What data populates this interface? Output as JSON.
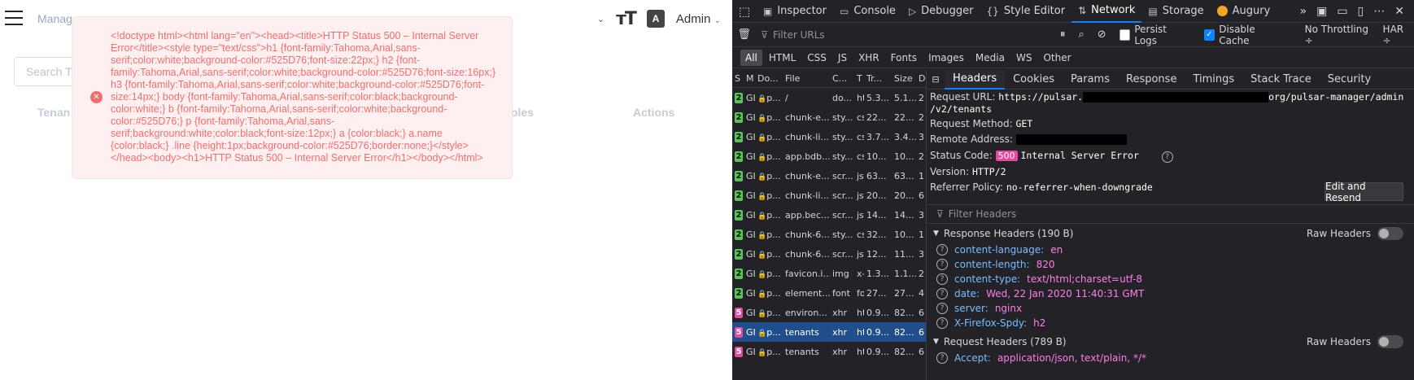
{
  "app": {
    "breadcrumb": "Manag",
    "admin_label": "Admin",
    "search_placeholder": "Search T",
    "table_headers": [
      "Tenan",
      "oles",
      "Actions"
    ],
    "error_message": "<!doctype html><html lang=\"en\"><head><title>HTTP Status 500 – Internal Server Error</title><style type=\"text/css\">h1 {font-family:Tahoma,Arial,sans-serif;color:white;background-color:#525D76;font-size:22px;} h2 {font-family:Tahoma,Arial,sans-serif;color:white;background-color:#525D76;font-size:16px;} h3 {font-family:Tahoma,Arial,sans-serif;color:white;background-color:#525D76;font-size:14px;} body {font-family:Tahoma,Arial,sans-serif;color:black;background-color:white;} b {font-family:Tahoma,Arial,sans-serif;color:white;background-color:#525D76;} p {font-family:Tahoma,Arial,sans-serif;background:white;color:black;font-size:12px;} a {color:black;} a.name {color:black;} .line {height:1px;background-color:#525D76;border:none;}</style></head><body><h1>HTTP Status 500 – Internal Server Error</h1></body></html>"
  },
  "devtools": {
    "tabs": [
      {
        "label": "Inspector",
        "icon": "inspector-icon"
      },
      {
        "label": "Console",
        "icon": "console-icon"
      },
      {
        "label": "Debugger",
        "icon": "debugger-icon"
      },
      {
        "label": "Style Editor",
        "icon": "style-editor-icon"
      },
      {
        "label": "Network",
        "icon": "network-icon"
      },
      {
        "label": "Storage",
        "icon": "storage-icon"
      },
      {
        "label": "Augury",
        "icon": "augury-icon"
      }
    ],
    "filter_placeholder": "Filter URLs",
    "persist_logs": "Persist Logs",
    "disable_cache": "Disable Cache",
    "throttling": "No Throttling ÷",
    "har": "HAR ÷",
    "type_filters": [
      "All",
      "HTML",
      "CSS",
      "JS",
      "XHR",
      "Fonts",
      "Images",
      "Media",
      "WS",
      "Other"
    ],
    "request_columns": [
      "S",
      "M",
      "Do...",
      "File",
      "C...",
      "T",
      "Tr...",
      "Size",
      "D"
    ],
    "requests": [
      {
        "status": "2",
        "method": "GI",
        "domain": "p...",
        "file": "/",
        "cause": "do...",
        "type": "ht",
        "transferred": "5.3...",
        "size": "5.1...",
        "extra": "2"
      },
      {
        "status": "2",
        "method": "GI",
        "domain": "p...",
        "file": "chunk-e...",
        "cause": "sty...",
        "type": "cs",
        "transferred": "22...",
        "size": "22...",
        "extra": "2"
      },
      {
        "status": "2",
        "method": "GI",
        "domain": "p...",
        "file": "chunk-li...",
        "cause": "sty...",
        "type": "cs",
        "transferred": "3.7...",
        "size": "3.4...",
        "extra": "3"
      },
      {
        "status": "2",
        "method": "GI",
        "domain": "p...",
        "file": "app.bdb...",
        "cause": "sty...",
        "type": "cs",
        "transferred": "10...",
        "size": "10...",
        "extra": "2"
      },
      {
        "status": "2",
        "method": "GI",
        "domain": "p...",
        "file": "chunk-e...",
        "cause": "scr...",
        "type": "js",
        "transferred": "63...",
        "size": "63...",
        "extra": "1"
      },
      {
        "status": "2",
        "method": "GI",
        "domain": "p...",
        "file": "chunk-li...",
        "cause": "scr...",
        "type": "js",
        "transferred": "20...",
        "size": "20...",
        "extra": "6"
      },
      {
        "status": "2",
        "method": "GI",
        "domain": "p...",
        "file": "app.bec...",
        "cause": "scr...",
        "type": "js",
        "transferred": "14...",
        "size": "14...",
        "extra": "3"
      },
      {
        "status": "2",
        "method": "GI",
        "domain": "p...",
        "file": "chunk-6...",
        "cause": "sty...",
        "type": "cs",
        "transferred": "32...",
        "size": "10...",
        "extra": "1"
      },
      {
        "status": "2",
        "method": "GI",
        "domain": "p...",
        "file": "chunk-6...",
        "cause": "scr...",
        "type": "js",
        "transferred": "12...",
        "size": "11...",
        "extra": "3"
      },
      {
        "status": "2",
        "method": "GI",
        "domain": "p...",
        "file": "favicon.i...",
        "cause": "img",
        "type": "x-",
        "transferred": "1.3...",
        "size": "1.1...",
        "extra": "2"
      },
      {
        "status": "2",
        "method": "GI",
        "domain": "p...",
        "file": "element...",
        "cause": "font",
        "type": "fo",
        "transferred": "27...",
        "size": "27...",
        "extra": "4"
      },
      {
        "status": "5",
        "method": "GI",
        "domain": "p...",
        "file": "environ...",
        "cause": "xhr",
        "type": "ht",
        "transferred": "0.9...",
        "size": "82...",
        "extra": "6"
      },
      {
        "status": "5",
        "method": "GI",
        "domain": "p...",
        "file": "tenants",
        "cause": "xhr",
        "type": "ht",
        "transferred": "0.9...",
        "size": "82...",
        "extra": "6"
      },
      {
        "status": "5",
        "method": "GI",
        "domain": "p...",
        "file": "tenants",
        "cause": "xhr",
        "type": "ht",
        "transferred": "0.9...",
        "size": "82...",
        "extra": "6"
      }
    ],
    "detail_tabs": [
      "Headers",
      "Cookies",
      "Params",
      "Response",
      "Timings",
      "Stack Trace",
      "Security"
    ],
    "request_url_label": "Request URL:",
    "request_url_prefix": "https://pulsar.",
    "request_url_suffix": "org/pulsar-manager/admin",
    "request_url_line2": "/v2/tenants",
    "request_method_label": "Request Method:",
    "request_method": "GET",
    "remote_address_label": "Remote Address:",
    "status_code_label": "Status Code:",
    "status_code": "500",
    "status_text": "Internal Server Error",
    "version_label": "Version:",
    "version": "HTTP/2",
    "referrer_label": "Referrer Policy:",
    "referrer": "no-referrer-when-downgrade",
    "edit_resend": "Edit and Resend",
    "filter_headers": "Filter Headers",
    "response_headers_title": "Response Headers (190 B)",
    "raw_headers": "Raw Headers",
    "response_headers": [
      {
        "name": "content-language:",
        "value": "en"
      },
      {
        "name": "content-length:",
        "value": "820"
      },
      {
        "name": "content-type:",
        "value": "text/html;charset=utf-8"
      },
      {
        "name": "date:",
        "value": "Wed, 22 Jan 2020 11:40:31 GMT"
      },
      {
        "name": "server:",
        "value": "nginx"
      },
      {
        "name": "X-Firefox-Spdy:",
        "value": "h2"
      }
    ],
    "request_headers_title": "Request Headers (789 B)",
    "request_headers": [
      {
        "name": "Accept:",
        "value": "application/json, text/plain, */*"
      }
    ]
  }
}
